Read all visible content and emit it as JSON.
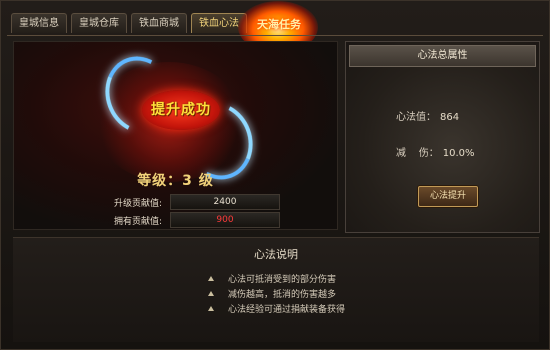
{
  "tabs": [
    {
      "label": "皇城信息",
      "active": false
    },
    {
      "label": "皇城仓库",
      "active": false
    },
    {
      "label": "铁血商城",
      "active": false
    },
    {
      "label": "铁血心法",
      "active": true
    }
  ],
  "quest_tab": {
    "label": "天海任务"
  },
  "left": {
    "success_text": "提升成功",
    "level_text": "等级：3 级",
    "upgrade_contribution": {
      "label": "升级贡献值:",
      "value": "2400"
    },
    "owned_contribution": {
      "label": "拥有贡献值:",
      "value": "900"
    }
  },
  "right": {
    "title": "心法总属性",
    "xinfa_label": "心法值：",
    "xinfa_value": "864",
    "reduce_label": "减    伤：",
    "reduce_value": "10.0%",
    "button_label": "心法提升"
  },
  "description": {
    "title": "心法说明",
    "items": [
      "心法可抵消受到的部分伤害",
      "减伤越高，抵消的伤害越多",
      "心法经验可通过捐献装备获得"
    ]
  },
  "icons": {
    "bullet": "up-triangle-icon"
  },
  "colors": {
    "accent": "#f0d27a",
    "deficit": "#ff3a3a"
  }
}
